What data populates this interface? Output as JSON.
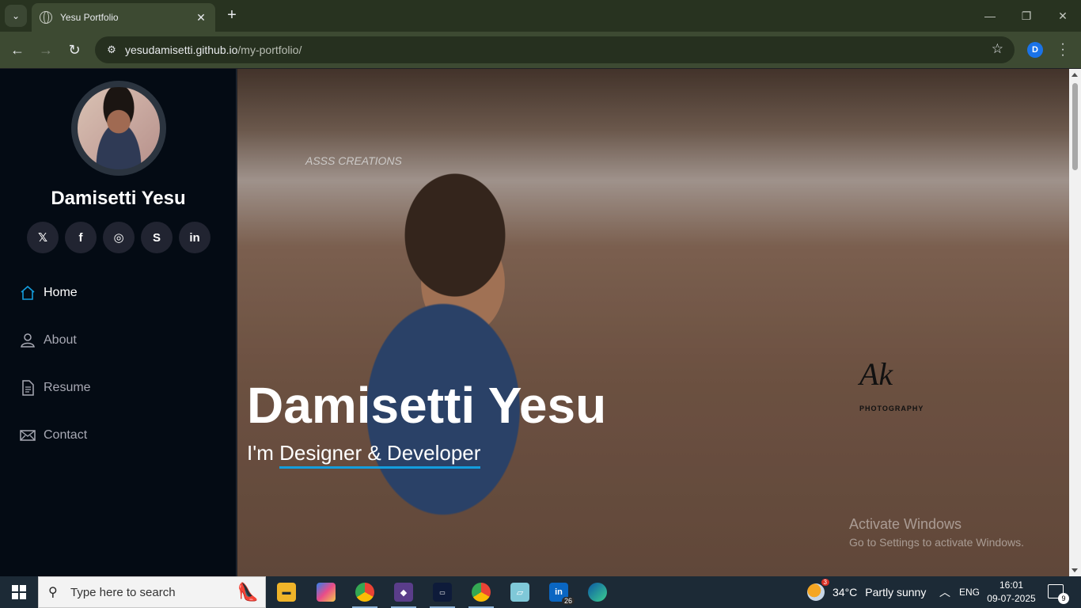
{
  "browser": {
    "tab_title": "Yesu Portfolio",
    "close_glyph": "✕",
    "new_tab_glyph": "+",
    "url_host": "yesudamisetti.github.io",
    "url_path": "/my-portfolio/",
    "profile_initial": "D"
  },
  "sidebar": {
    "name": "Damisetti Yesu",
    "socials": [
      {
        "icon": "x-icon",
        "glyph": "𝕏"
      },
      {
        "icon": "facebook-icon",
        "glyph": "f"
      },
      {
        "icon": "instagram-icon",
        "glyph": "◎"
      },
      {
        "icon": "skype-icon",
        "glyph": "S"
      },
      {
        "icon": "linkedin-icon",
        "glyph": "in"
      }
    ],
    "nav": [
      {
        "label": "Home",
        "icon": "house-icon",
        "active": true
      },
      {
        "label": "About",
        "icon": "person-icon",
        "active": false
      },
      {
        "label": "Resume",
        "icon": "file-text-icon",
        "active": false
      },
      {
        "label": "Contact",
        "icon": "envelope-icon",
        "active": false
      }
    ]
  },
  "hero": {
    "title": "Damisetti Yesu",
    "subtitle_prefix": "I'm ",
    "subtitle_typed": "Designer & Developer",
    "watermark_right": "Ak",
    "watermark_right_sub": "PHOTOGRAPHY",
    "watermark_left": "ASSS CREATIONS"
  },
  "activation": {
    "line1": "Activate Windows",
    "line2": "Go to Settings to activate Windows."
  },
  "taskbar": {
    "search_placeholder": "Type here to search",
    "weather_temp": "34°C",
    "weather_text": "Partly sunny",
    "weather_badge": "3",
    "language": "ENG",
    "time": "16:01",
    "date": "09-07-2025",
    "notification_count": "9",
    "linkedin_badge": "26",
    "accent": "#149ddd"
  }
}
